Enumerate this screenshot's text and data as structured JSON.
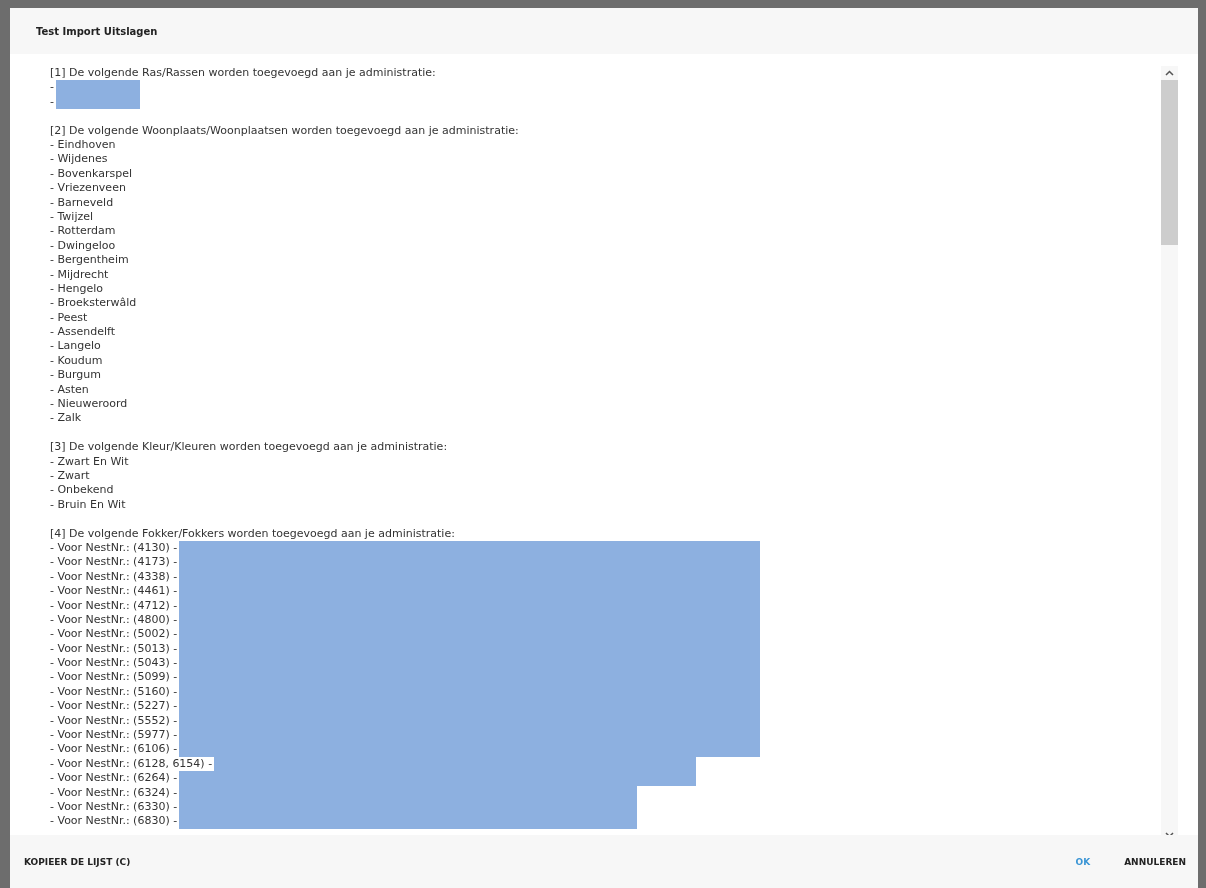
{
  "dialog": {
    "title": "Test Import Uitslagen"
  },
  "sections": [
    {
      "heading": "[1] De volgende Ras/Rassen worden toegevoegd aan je administratie:",
      "lines": [
        {
          "text": "-",
          "kind": "short"
        },
        {
          "text": "-",
          "kind": "short"
        }
      ]
    },
    {
      "heading": "[2] De volgende Woonplaats/Woonplaatsen worden toegevoegd aan je administratie:",
      "lines": [
        {
          "text": "- Eindhoven"
        },
        {
          "text": "- Wijdenes"
        },
        {
          "text": "- Bovenkarspel"
        },
        {
          "text": "- Vriezenveen"
        },
        {
          "text": "- Barneveld"
        },
        {
          "text": "- Twijzel"
        },
        {
          "text": "- Rotterdam"
        },
        {
          "text": "- Dwingeloo"
        },
        {
          "text": "- Bergentheim"
        },
        {
          "text": "- Mijdrecht"
        },
        {
          "text": "- Hengelo"
        },
        {
          "text": "- Broeksterwâld"
        },
        {
          "text": "- Peest"
        },
        {
          "text": "- Assendelft"
        },
        {
          "text": "- Langelo"
        },
        {
          "text": "- Koudum"
        },
        {
          "text": "- Burgum"
        },
        {
          "text": "- Asten"
        },
        {
          "text": "- Nieuweroord"
        },
        {
          "text": "- Zalk"
        }
      ]
    },
    {
      "heading": "[3] De volgende Kleur/Kleuren worden toegevoegd aan je administratie:",
      "lines": [
        {
          "text": "- Zwart En Wit"
        },
        {
          "text": "- Zwart"
        },
        {
          "text": "- Onbekend"
        },
        {
          "text": "- Bruin En Wit"
        }
      ]
    },
    {
      "heading": "[4] De volgende Fokker/Fokkers worden toegevoegd aan je administratie:",
      "lines": [
        {
          "text": "- Voor NestNr.: (4130) -",
          "kind": "wide"
        },
        {
          "text": "- Voor NestNr.: (4173) -",
          "kind": "wide"
        },
        {
          "text": "- Voor NestNr.: (4338) -",
          "kind": "wide"
        },
        {
          "text": "- Voor NestNr.: (4461) -",
          "kind": "wide"
        },
        {
          "text": "- Voor NestNr.: (4712) -",
          "kind": "wide"
        },
        {
          "text": "- Voor NestNr.: (4800) -",
          "kind": "wide"
        },
        {
          "text": "- Voor NestNr.: (5002) -",
          "kind": "wide"
        },
        {
          "text": "- Voor NestNr.: (5013) -",
          "kind": "wide"
        },
        {
          "text": "- Voor NestNr.: (5043) -",
          "kind": "wide"
        },
        {
          "text": "- Voor NestNr.: (5099) -",
          "kind": "wide"
        },
        {
          "text": "- Voor NestNr.: (5160) -",
          "kind": "wide"
        },
        {
          "text": "- Voor NestNr.: (5227) -",
          "kind": "wide"
        },
        {
          "text": "- Voor NestNr.: (5552) -",
          "kind": "wide"
        },
        {
          "text": "- Voor NestNr.: (5977) -",
          "kind": "wide"
        },
        {
          "text": "- Voor NestNr.: (6106) -",
          "kind": "wide"
        },
        {
          "text": "- Voor NestNr.: (6128, 6154) -",
          "kind": "medium"
        },
        {
          "text": "- Voor NestNr.: (6264) -",
          "kind": "medium"
        },
        {
          "text": "- Voor NestNr.: (6324) -",
          "kind": "narrow"
        },
        {
          "text": "- Voor NestNr.: (6330) -",
          "kind": "narrow"
        },
        {
          "text": "- Voor NestNr.: (6830) -",
          "kind": "narrow"
        }
      ]
    }
  ],
  "footer": {
    "copy_button": "KOPIEER DE LIJST (C)",
    "ok_button": "OK",
    "cancel_button": "ANNULEREN"
  }
}
